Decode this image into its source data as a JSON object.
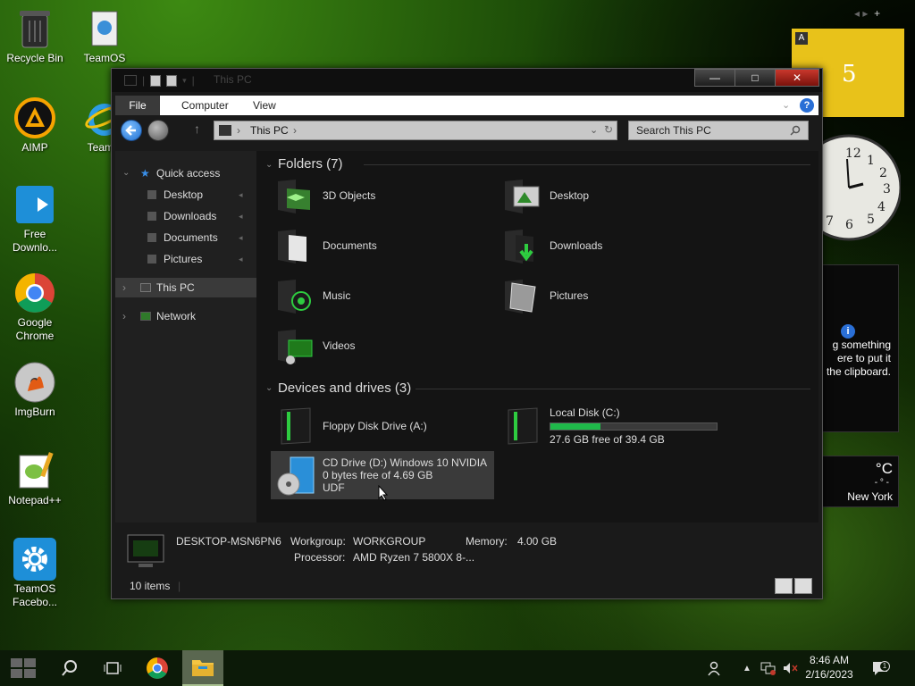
{
  "desktop": {
    "icons": [
      {
        "label": "Recycle Bin",
        "icon": "recycle-bin-icon"
      },
      {
        "label": "TeamOS",
        "icon": "document-icon"
      },
      {
        "label": "AIMP",
        "icon": "aimp-icon"
      },
      {
        "label": "TeamO",
        "icon": "internet-explorer-icon"
      },
      {
        "label": "Free Downlo...",
        "icon": "download-manager-icon"
      },
      {
        "label": "Google Chrome",
        "icon": "chrome-icon"
      },
      {
        "label": "ImgBurn",
        "icon": "disc-burn-icon"
      },
      {
        "label": "Notepad++",
        "icon": "notepad-plus-icon"
      },
      {
        "label": "TeamOS Facebo...",
        "icon": "gear-icon"
      }
    ]
  },
  "window": {
    "title": "This PC",
    "controls": {
      "minimize": "—",
      "maximize": "□",
      "close": "✕"
    },
    "ribbon": {
      "tabs": [
        "File",
        "Computer",
        "View"
      ]
    },
    "address": {
      "location": "This PC"
    },
    "search": {
      "placeholder": "Search This PC"
    },
    "sidebar": {
      "quick_access": "Quick access",
      "items": [
        "Desktop",
        "Downloads",
        "Documents",
        "Pictures"
      ],
      "this_pc": "This PC",
      "network": "Network"
    },
    "folders": {
      "heading": "Folders (7)",
      "items": [
        "3D Objects",
        "Desktop",
        "Documents",
        "Downloads",
        "Music",
        "Pictures",
        "Videos"
      ]
    },
    "devices": {
      "heading": "Devices and drives (3)",
      "floppy": "Floppy Disk Drive (A:)",
      "local_disk": {
        "name": "Local Disk (C:)",
        "free": "27.6 GB free of 39.4 GB",
        "used_fraction": 0.3
      },
      "cd_drive": {
        "name": "CD Drive (D:) Windows 10 NVIDIA",
        "free": "0 bytes free of 4.69 GB",
        "fs": "UDF"
      }
    },
    "details": {
      "computer_name": "DESKTOP-MSN6PN6",
      "workgroup_label": "Workgroup:",
      "workgroup": "WORKGROUP",
      "memory_label": "Memory:",
      "memory": "4.00 GB",
      "processor_label": "Processor:",
      "processor": "AMD Ryzen 7 5800X 8-..."
    },
    "status": {
      "items": "10 items"
    }
  },
  "widgets": {
    "yellow": {
      "letter": "A",
      "number": "5"
    },
    "clipboard_text": "g something ere to put it the clipboard.",
    "weather": {
      "unit": "°C",
      "city": "New York",
      "dash": "- ° -"
    }
  },
  "taskbar": {
    "time": "8:46 AM",
    "date": "2/16/2023",
    "notification_count": "1"
  },
  "colors": {
    "accent": "#1fb84a",
    "sidebar": "#202020",
    "content": "#141414"
  }
}
